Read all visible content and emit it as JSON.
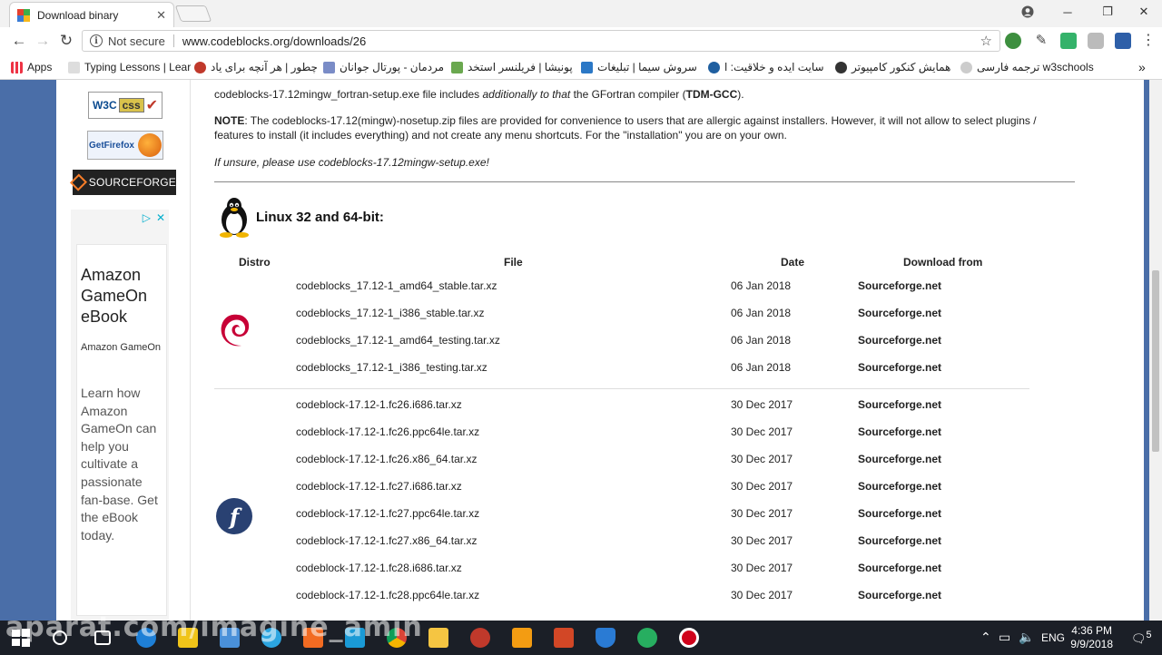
{
  "browser": {
    "tab_title": "Download binary",
    "not_secure": "Not secure",
    "url": "www.codeblocks.org/downloads/26"
  },
  "bookmarks": [
    "Apps",
    "Typing Lessons | Lear",
    "چطور | هر آنچه برای یاد",
    "مردمان - پورتال جوانان",
    "پونیشا | فریلنسر استخد",
    "سروش سیما | تبلیغات",
    "سایت ایده و خلاقیت: ا",
    "همایش کنکور کامپیوتر",
    "ترجمه فارسی w3schools"
  ],
  "sidebar": {
    "w3c_label": "W3C",
    "css_label": "css",
    "firefox_label": "GetFirefox",
    "sourceforge_label": "SOURCEFORGE",
    "ad": {
      "title": "Amazon GameOn eBook",
      "sponsor": "Amazon GameOn",
      "body": "Learn how Amazon GameOn can help you cultivate a passionate fan-base. Get the eBook today."
    }
  },
  "content": {
    "note1_a": "codeblocks-17.12mingw_fortran-setup.exe file includes ",
    "note1_b": "additionally to that",
    "note1_c": " the GFortran compiler (",
    "note1_d": "TDM-GCC",
    "note1_e": ").",
    "note2_label": "NOTE",
    "note2_text": ": The codeblocks-17.12(mingw)-nosetup.zip files are provided for convenience to users that are allergic against installers. However, it will not allow to select plugins / features to install (it includes everything) and not create any menu shortcuts. For the \"installation\" you are on your own.",
    "note3": "If unsure, please use codeblocks-17.12mingw-setup.exe!",
    "linux_title": "Linux 32 and 64-bit:"
  },
  "table": {
    "headers": {
      "distro": "Distro",
      "file": "File",
      "date": "Date",
      "source": "Download from"
    },
    "rows": [
      {
        "file": "codeblocks_17.12-1_amd64_stable.tar.xz",
        "date": "06 Jan 2018",
        "source": "Sourceforge.net"
      },
      {
        "file": "codeblocks_17.12-1_i386_stable.tar.xz",
        "date": "06 Jan 2018",
        "source": "Sourceforge.net"
      },
      {
        "file": "codeblocks_17.12-1_amd64_testing.tar.xz",
        "date": "06 Jan 2018",
        "source": "Sourceforge.net"
      },
      {
        "file": "codeblocks_17.12-1_i386_testing.tar.xz",
        "date": "06 Jan 2018",
        "source": "Sourceforge.net"
      },
      {
        "file": "codeblock-17.12-1.fc26.i686.tar.xz",
        "date": "30 Dec 2017",
        "source": "Sourceforge.net"
      },
      {
        "file": "codeblock-17.12-1.fc26.ppc64le.tar.xz",
        "date": "30 Dec 2017",
        "source": "Sourceforge.net"
      },
      {
        "file": "codeblock-17.12-1.fc26.x86_64.tar.xz",
        "date": "30 Dec 2017",
        "source": "Sourceforge.net"
      },
      {
        "file": "codeblock-17.12-1.fc27.i686.tar.xz",
        "date": "30 Dec 2017",
        "source": "Sourceforge.net"
      },
      {
        "file": "codeblock-17.12-1.fc27.ppc64le.tar.xz",
        "date": "30 Dec 2017",
        "source": "Sourceforge.net"
      },
      {
        "file": "codeblock-17.12-1.fc27.x86_64.tar.xz",
        "date": "30 Dec 2017",
        "source": "Sourceforge.net"
      },
      {
        "file": "codeblock-17.12-1.fc28.i686.tar.xz",
        "date": "30 Dec 2017",
        "source": "Sourceforge.net"
      },
      {
        "file": "codeblock-17.12-1.fc28.ppc64le.tar.xz",
        "date": "30 Dec 2017",
        "source": "Sourceforge.net"
      }
    ]
  },
  "taskbar": {
    "watermark": "aparat.com/imagine_amin",
    "time": "4:36 PM",
    "date": "9/9/2018",
    "lang": "ENG",
    "notifications": "5"
  }
}
